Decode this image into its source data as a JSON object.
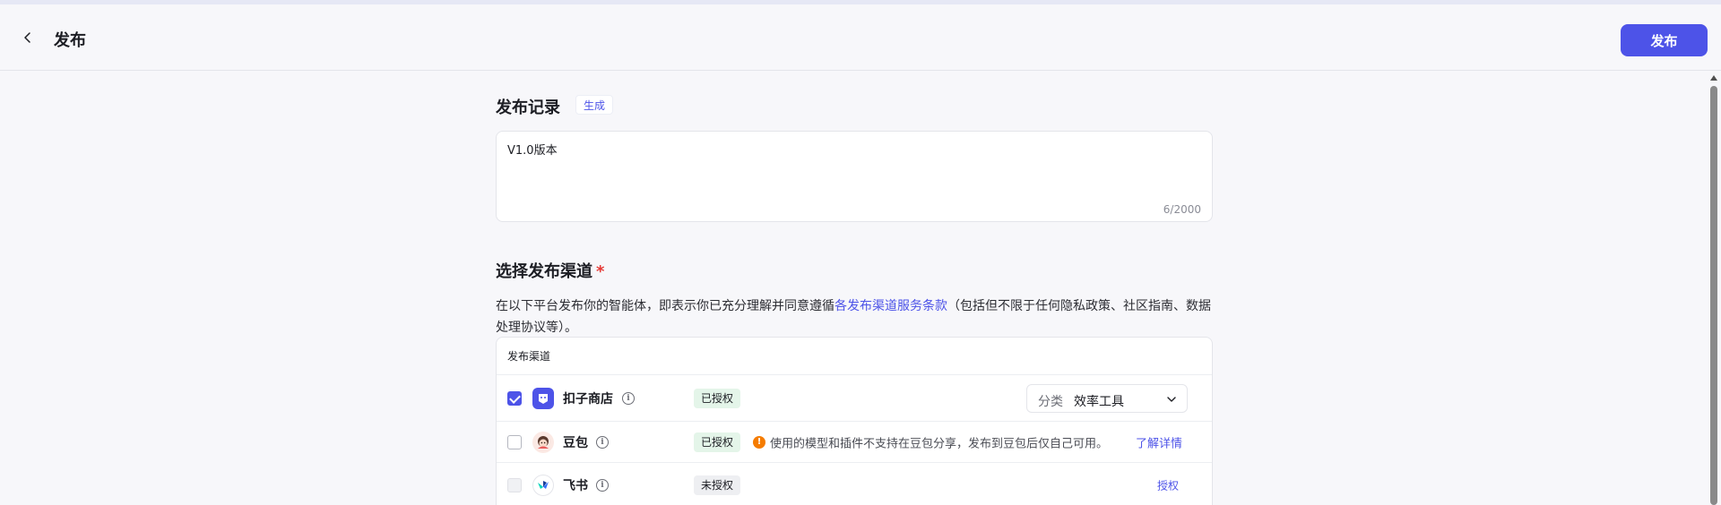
{
  "header": {
    "title": "发布",
    "publish_label": "发布"
  },
  "record": {
    "title": "发布记录",
    "generate_label": "生成",
    "text": "V1.0版本",
    "count": "6/2000"
  },
  "channels": {
    "title": "选择发布渠道",
    "required_mark": "*",
    "desc_before": "在以下平台发布你的智能体，即表示你已充分理解并同意遵循",
    "desc_link": "各发布渠道服务条款",
    "desc_after": "（包括但不限于任何隐私政策、社区指南、数据处理协议等）。",
    "table_header": "发布渠道",
    "rows": [
      {
        "name": "扣子商店",
        "icon": "coze-store-icon",
        "checked": true,
        "status": "已授权",
        "category_label": "分类",
        "category_value": "效率工具"
      },
      {
        "name": "豆包",
        "icon": "doubao-icon",
        "checked": false,
        "status": "已授权",
        "warning": "使用的模型和插件不支持在豆包分享，发布到豆包后仅自己可用。",
        "detail_link": "了解详情"
      },
      {
        "name": "飞书",
        "icon": "feishu-icon",
        "checked": false,
        "disabled": true,
        "status": "未授权",
        "action": "授权"
      }
    ]
  },
  "colors": {
    "accent": "#4d53e8",
    "authorized_bg": "#e4f5e9",
    "unauthorized_bg": "#eeeff2",
    "warning": "#f57c00"
  }
}
